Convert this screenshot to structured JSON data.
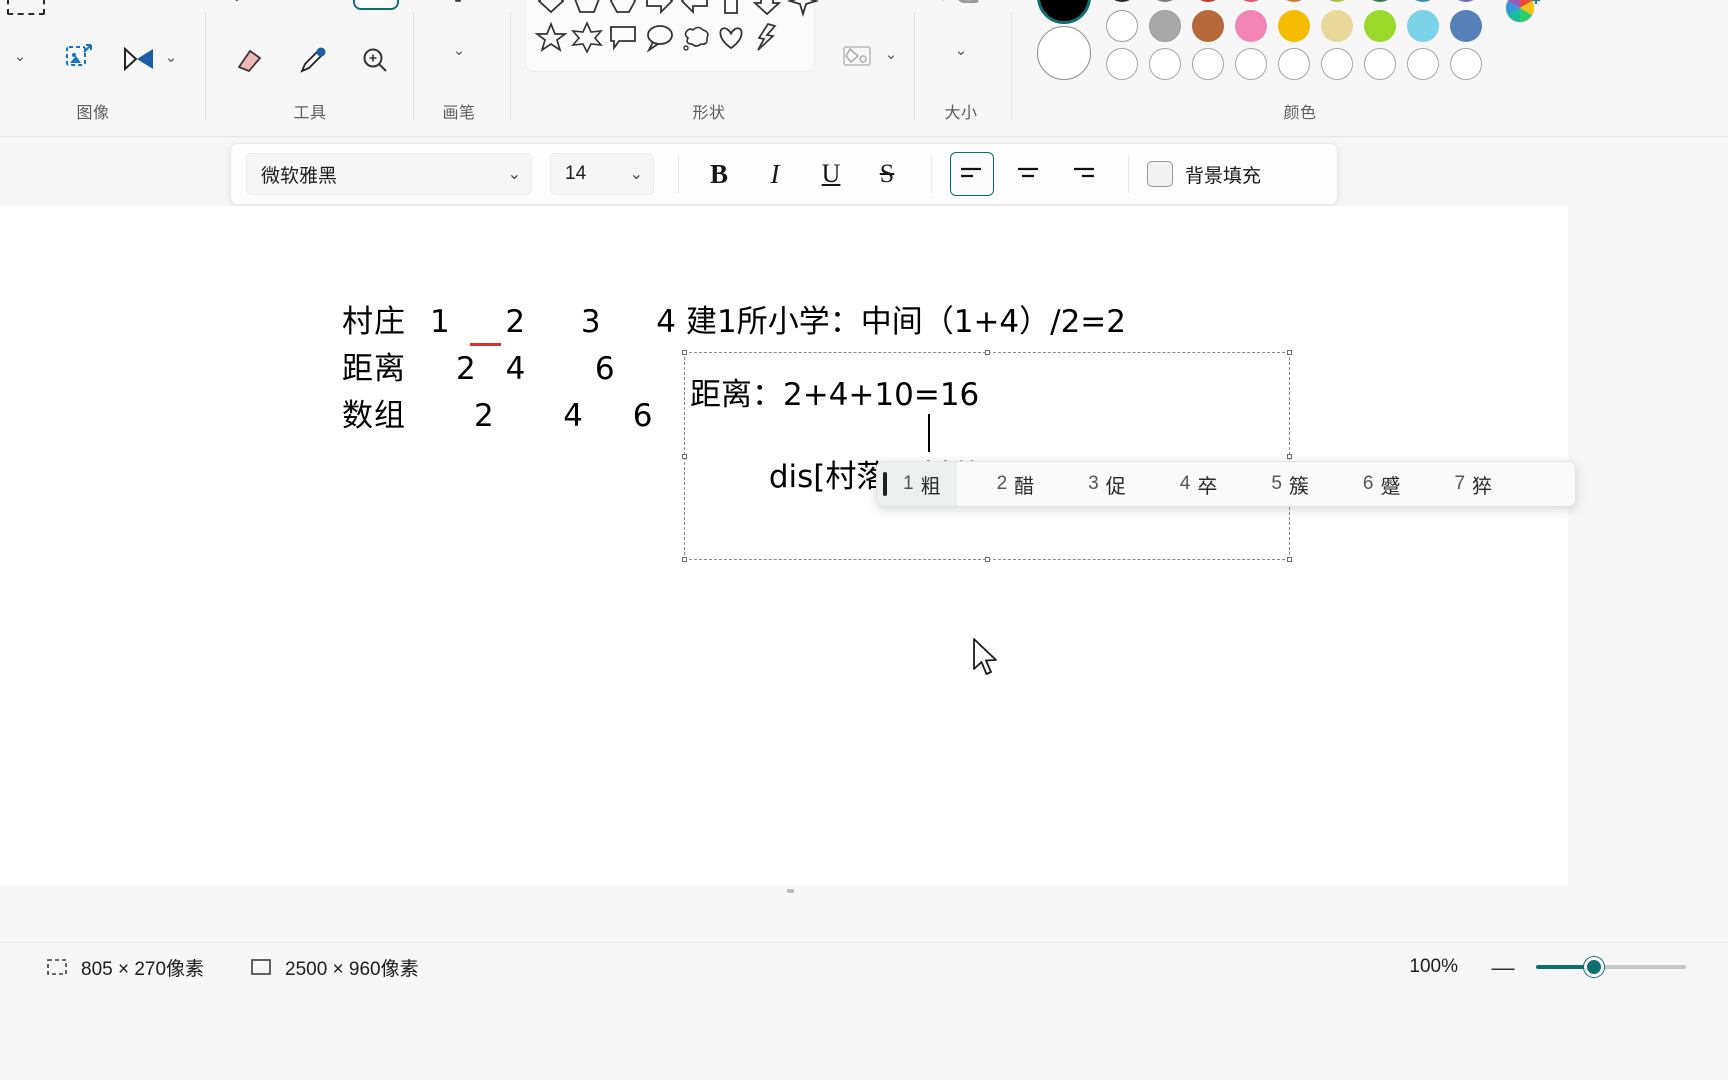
{
  "ribbon": {
    "groups": [
      {
        "label": "图像",
        "name": "image"
      },
      {
        "label": "工具",
        "name": "tools"
      },
      {
        "label": "画笔",
        "name": "brushes"
      },
      {
        "label": "形状",
        "name": "shapes"
      },
      {
        "label": "大小",
        "name": "size"
      },
      {
        "label": "颜色",
        "name": "colors"
      }
    ],
    "shape_row2": [
      "diamond",
      "pentagon",
      "hexagon",
      "right-arrow",
      "left-arrow",
      "up-arrow",
      "down-arrow",
      "four-point-star"
    ],
    "shape_row3": [
      "five-point-star",
      "six-point-star",
      "rounded-callout",
      "oval-callout",
      "cloud-callout",
      "heart",
      "lightning"
    ],
    "palette_row1": [
      "#ffffff",
      "#a8a8a8",
      "#b5683a",
      "#f186b4",
      "#f5bd00",
      "#e8d99b",
      "#9ad92a",
      "#7cd2e8",
      "#5580b8"
    ],
    "palette_row2": [
      "#ffffff",
      "#ffffff",
      "#ffffff",
      "#ffffff",
      "#ffffff",
      "#ffffff",
      "#ffffff",
      "#ffffff",
      "#ffffff"
    ],
    "primary_color": "#000000",
    "secondary_color": "#ffffff"
  },
  "format_bar": {
    "font_family": "微软雅黑",
    "font_size": "14",
    "bold": "B",
    "italic": "I",
    "underline": "U",
    "strikethrough": "S",
    "align_left": "align-left",
    "align_center": "align-center",
    "align_right": "align-right",
    "background_fill_label": "背景填充",
    "background_fill_checked": false,
    "active_align": "left"
  },
  "canvas": {
    "left_block": {
      "row1": {
        "label": "村庄",
        "values": "1  2  3  4"
      },
      "row2": {
        "label": "距离",
        "values": "2 4   6"
      },
      "row3": {
        "label": "数组",
        "values": "2   4  6"
      },
      "underline_color": "#d6332f",
      "underlined_value": "2"
    },
    "heading": "建1所小学：中间（1+4）/2=2",
    "textbox": {
      "line1": "距离：2+4+10=16",
      "line2_prefix": "dis[村落i][村落j]:",
      "line2_composition": "cu"
    }
  },
  "ime": {
    "candidates": [
      {
        "num": "1",
        "word": "粗"
      },
      {
        "num": "2",
        "word": "醋"
      },
      {
        "num": "3",
        "word": "促"
      },
      {
        "num": "4",
        "word": "卒"
      },
      {
        "num": "5",
        "word": "簇"
      },
      {
        "num": "6",
        "word": "蹙"
      },
      {
        "num": "7",
        "word": "猝"
      }
    ],
    "selected_index": 0
  },
  "status_bar": {
    "selection_size": "805 × 270像素",
    "image_size": "2500 × 960像素",
    "zoom_level": "100%",
    "zoom_minus": "—"
  }
}
